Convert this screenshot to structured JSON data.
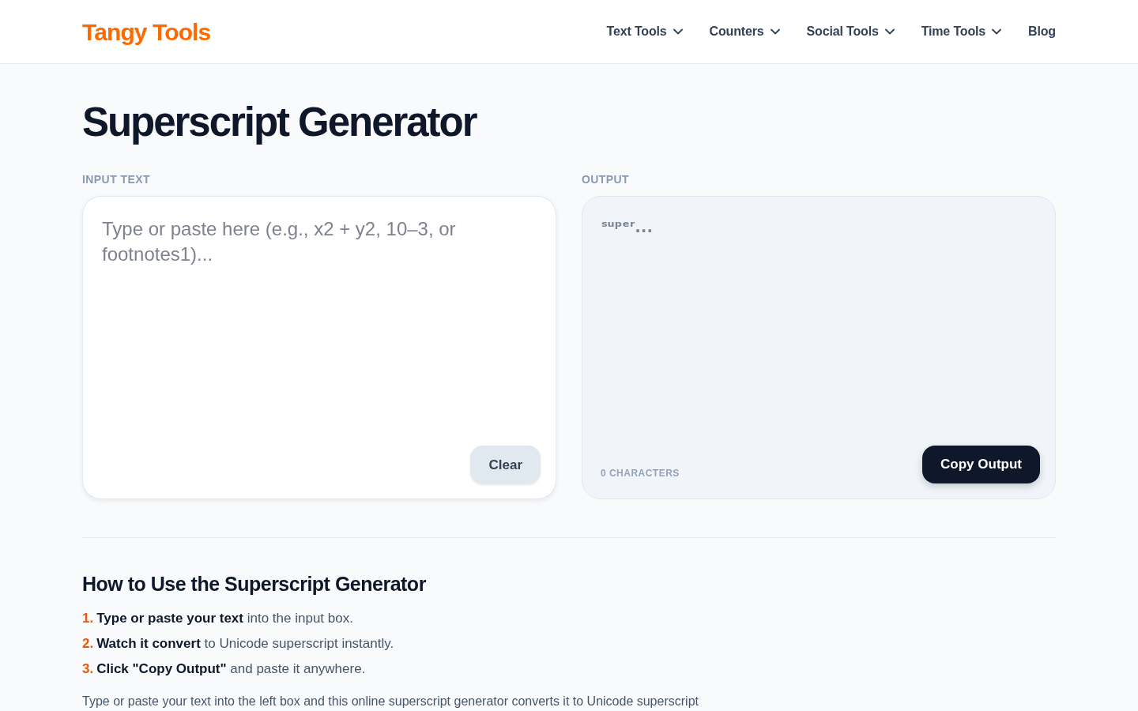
{
  "header": {
    "logo": "Tangy Tools",
    "nav": [
      {
        "label": "Text Tools",
        "dropdown": true
      },
      {
        "label": "Counters",
        "dropdown": true
      },
      {
        "label": "Social Tools",
        "dropdown": true
      },
      {
        "label": "Time Tools",
        "dropdown": true
      },
      {
        "label": "Blog",
        "dropdown": false
      }
    ]
  },
  "page_title": "Superscript Generator",
  "input": {
    "label": "INPUT TEXT",
    "placeholder": "Type or paste here (e.g., x2 + y2, 10–3, or footnotes1)...",
    "button": "Clear"
  },
  "output": {
    "label": "OUTPUT",
    "placeholder": "ˢᵘᵖᵉʳ...",
    "count": "0 CHARACTERS",
    "button": "Copy Output"
  },
  "how_to": {
    "heading": "How to Use the Superscript Generator",
    "steps": [
      {
        "number": "1.",
        "text": "**Type or paste your text** into the input box."
      },
      {
        "number": "2.",
        "text": "**Watch it convert** to Unicode superscript instantly."
      },
      {
        "number": "3.",
        "text": "**Click \"Copy Output\"** and paste it anywhere."
      }
    ]
  },
  "intro": "Type or paste your text into the left box and this online superscript generator converts it to Unicode superscript"
}
